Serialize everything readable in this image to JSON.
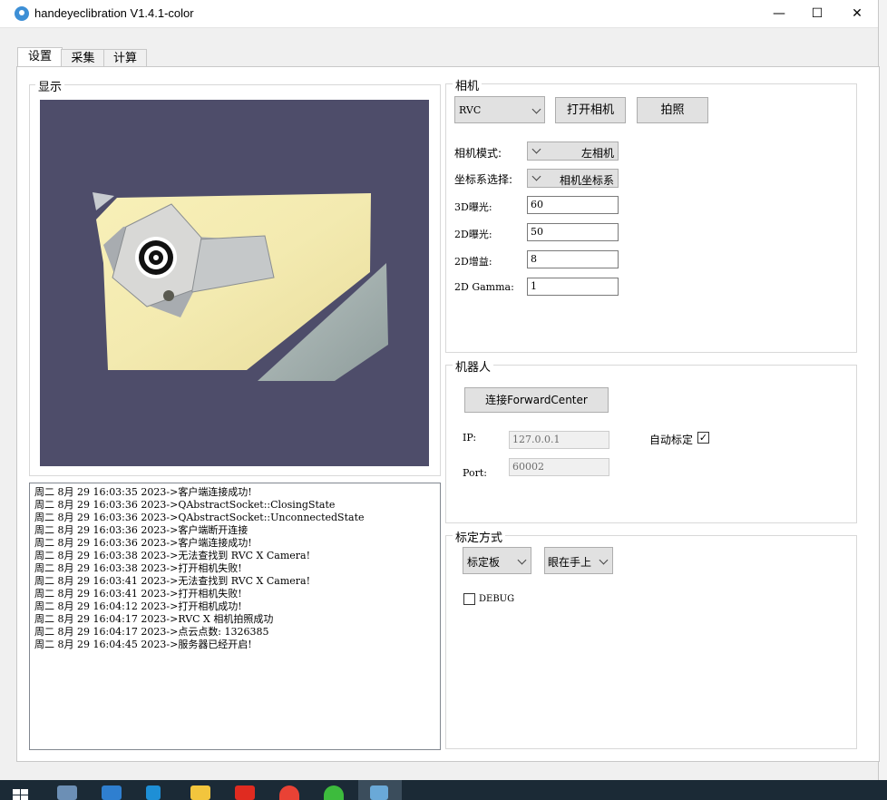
{
  "window": {
    "title": "handeyeclibration V1.4.1-color",
    "minimize_glyph": "—",
    "maximize_glyph": "☐",
    "close_glyph": "✕"
  },
  "tabs": [
    {
      "label": "设置"
    },
    {
      "label": "采集"
    },
    {
      "label": "计算"
    }
  ],
  "display": {
    "title": "显示"
  },
  "log": {
    "lines": [
      "周二 8月 29 16:03:35 2023->客户端连接成功!",
      "周二 8月 29 16:03:36 2023->QAbstractSocket::ClosingState",
      "周二 8月 29 16:03:36 2023->QAbstractSocket::UnconnectedState",
      "周二 8月 29 16:03:36 2023->客户端断开连接",
      "周二 8月 29 16:03:36 2023->客户端连接成功!",
      "周二 8月 29 16:03:38 2023->无法查找到 RVC X Camera!",
      "周二 8月 29 16:03:38 2023->打开相机失败!",
      "周二 8月 29 16:03:41 2023->无法查找到 RVC X Camera!",
      "周二 8月 29 16:03:41 2023->打开相机失败!",
      "周二 8月 29 16:04:12 2023->打开相机成功!",
      "周二 8月 29 16:04:17 2023->RVC X 相机拍照成功",
      "周二 8月 29 16:04:17 2023->点云点数: 1326385",
      "周二 8月 29 16:04:45 2023->服务器已经开启!"
    ]
  },
  "camera": {
    "title": "相机",
    "model_select": "RVC",
    "open_button": "打开相机",
    "capture_button": "拍照",
    "mode_label": "相机模式:",
    "mode_value": "左相机",
    "coord_label": "坐标系选择:",
    "coord_value": "相机坐标系",
    "exposure3d_label": "3D曝光:",
    "exposure3d_value": "60",
    "exposure2d_label": "2D曝光:",
    "exposure2d_value": "50",
    "gain2d_label": "2D增益:",
    "gain2d_value": "8",
    "gamma2d_label": "2D Gamma:",
    "gamma2d_value": "1"
  },
  "robot": {
    "title": "机器人",
    "connect_button": "连接ForwardCenter",
    "ip_label": "IP:",
    "ip_value": "127.0.0.1",
    "port_label": "Port:",
    "port_value": "60002",
    "auto_calib_label": "自动标定",
    "auto_calib_checked": true,
    "check_glyph": "✓"
  },
  "calibration": {
    "title": "标定方式",
    "target_select": "标定板",
    "eye_select": "眼在手上",
    "debug_label": "DEBUG",
    "debug_checked": false
  },
  "colors": {
    "view_background": "#4e4d6a",
    "taskbar": "#1b2a36"
  }
}
